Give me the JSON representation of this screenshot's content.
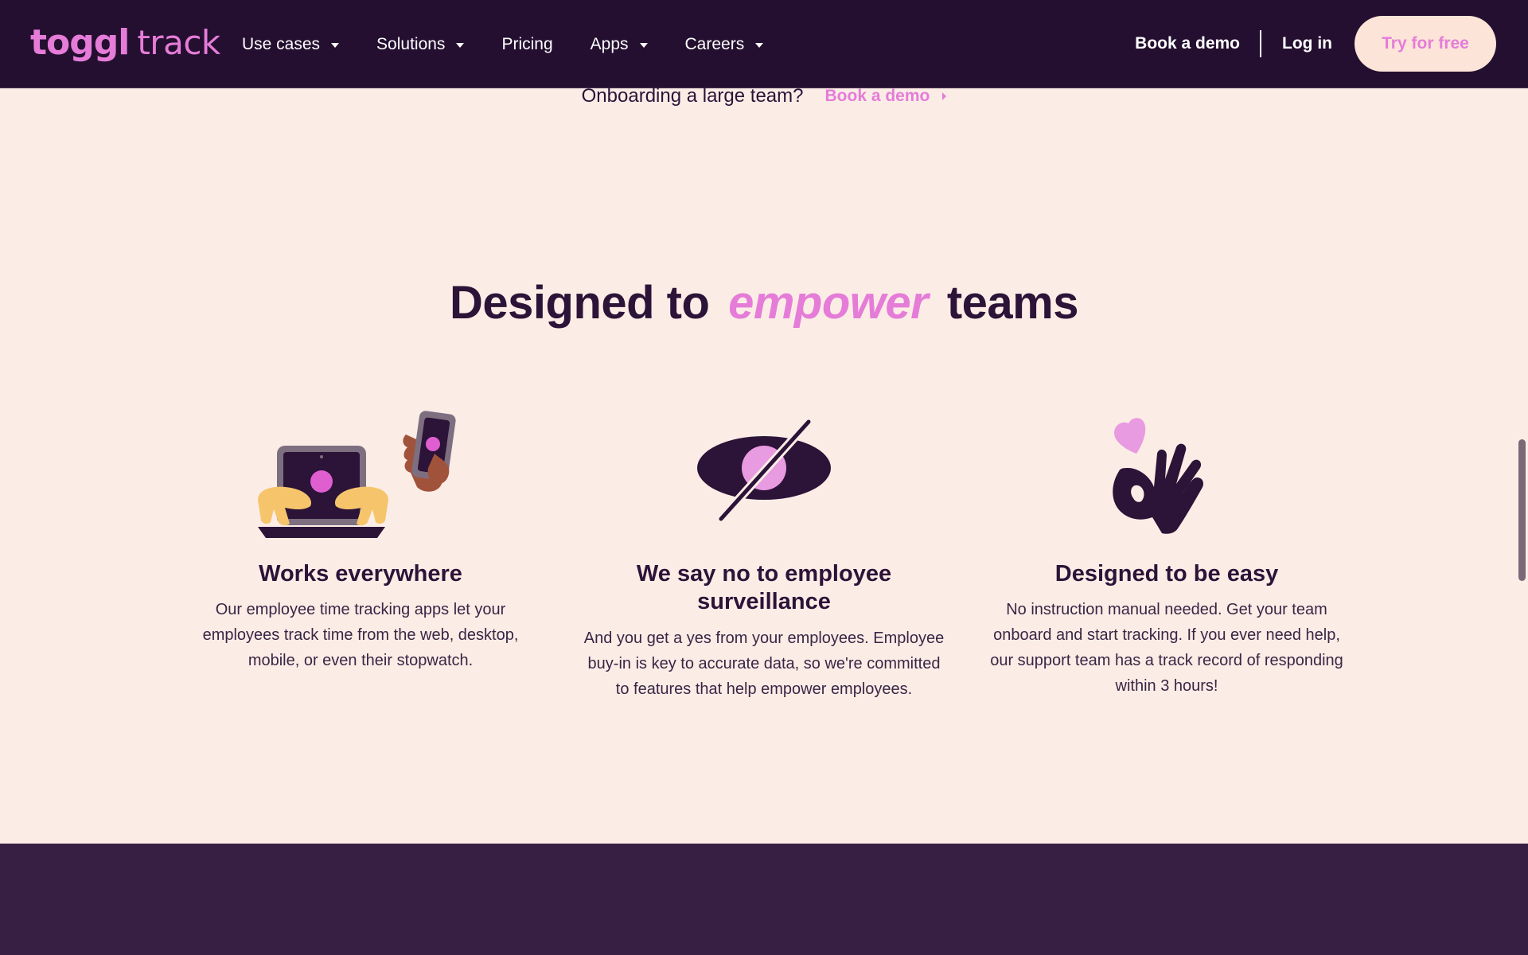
{
  "nav": {
    "logo_primary": "toggl",
    "logo_secondary": "track",
    "items": [
      {
        "label": "Use cases",
        "has_dropdown": true
      },
      {
        "label": "Solutions",
        "has_dropdown": true
      },
      {
        "label": "Pricing",
        "has_dropdown": false
      },
      {
        "label": "Apps",
        "has_dropdown": true
      },
      {
        "label": "Careers",
        "has_dropdown": true
      }
    ],
    "book_demo": "Book a demo",
    "log_in": "Log in",
    "try_free": "Try for free"
  },
  "onboard": {
    "text": "Onboarding a large team?",
    "link": "Book a demo"
  },
  "headline": {
    "before": "Designed to",
    "accent": "empower",
    "after": "teams"
  },
  "features": [
    {
      "icon": "laptop-phone-hands-illustration",
      "title": "Works everywhere",
      "body": "Our employee time tracking apps let your employees track time from the web, desktop, mobile, or even their stopwatch."
    },
    {
      "icon": "crossed-eye-illustration",
      "title": "We say no to employee surveillance",
      "body": "And you get a yes from your employees. Employee buy-in is key to accurate data, so we're committed to features that help empower employees."
    },
    {
      "icon": "ok-hand-heart-illustration",
      "title": "Designed to be easy",
      "body": "No instruction manual needed. Get your team onboard and start tracking. If you ever need help, our support team has a track record of responding within 3 hours!"
    }
  ],
  "colors": {
    "nav_bg": "#240f30",
    "page_bg": "#fbede6",
    "accent": "#e57cd8",
    "text_dark": "#2c1338",
    "button_bg": "#fce5d8",
    "footer_band": "#361f43"
  }
}
